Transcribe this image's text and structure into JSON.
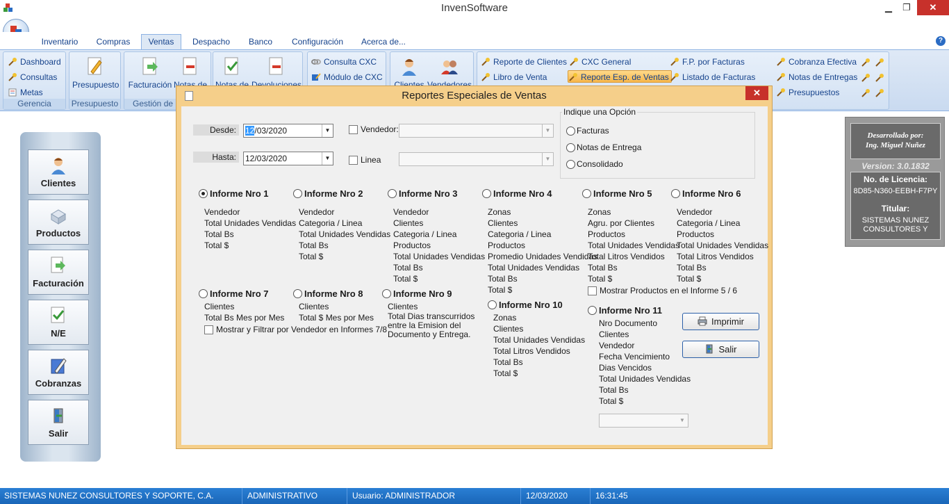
{
  "window": {
    "title": "InvenSoftware",
    "close": "✕",
    "min": "▁",
    "max": "❐"
  },
  "tabs": [
    "Inventario",
    "Compras",
    "Ventas",
    "Despacho",
    "Banco",
    "Configuración",
    "Acerca de..."
  ],
  "help": "?",
  "ribbon": {
    "gerencia": {
      "title": "Gerencia",
      "items": [
        "Dashboard",
        "Consultas",
        "Metas"
      ]
    },
    "presupuesto": {
      "title": "Presupuesto",
      "label": "Presupuesto"
    },
    "gestion": {
      "title": "Gestión de",
      "items": [
        "Facturación",
        "Notas de"
      ]
    },
    "notas": {
      "items": [
        "Notas de",
        "Devoluciones"
      ]
    },
    "cxc": {
      "items": [
        "Consulta CXC",
        "Módulo de CXC"
      ]
    },
    "clientes": {
      "items": [
        "Clientes",
        "Vendedores"
      ]
    },
    "reportes": {
      "col1": [
        "Reporte de Clientes",
        "Libro de Venta"
      ],
      "col2": [
        "CXC General",
        "Reporte Esp. de Ventas"
      ],
      "col3": [
        "F.P. por Facturas",
        "Listado de Facturas"
      ],
      "col4": [
        "Cobranza Efectiva",
        "Notas de Entregas",
        "Presupuestos"
      ]
    }
  },
  "leftnav": [
    "Clientes",
    "Productos",
    "Facturación",
    "N/E",
    "Cobranzas",
    "Salir"
  ],
  "info": {
    "dev_line1": "Desarrollado por:",
    "dev_line2": "Ing. Miguel Nuñez",
    "version": "Version: 3.0.1832",
    "license_label": "No. de Licencia:",
    "license_value": "8D85-N360-EEBH-F7PY",
    "holder_label": "Titular:",
    "holder_value": "SISTEMAS NUNEZ CONSULTORES Y SOPORTE, C.A."
  },
  "dialog": {
    "title": "Reportes Especiales de Ventas",
    "desde_label": "Desde:",
    "desde_sel": "12",
    "desde_rest": "/03/2020",
    "hasta_label": "Hasta:",
    "hasta_value": "12/03/2020",
    "vendedor_label": "Vendedor:",
    "linea_label": "Linea",
    "option_group": "Indique una Opción",
    "options": [
      "Facturas",
      "Notas de Entrega",
      "Consolidado"
    ],
    "reports": [
      {
        "title": "Informe Nro 1",
        "items": [
          "Vendedor",
          "Total Unidades Vendidas",
          "Total Bs",
          "Total $"
        ]
      },
      {
        "title": "Informe Nro 2",
        "items": [
          "Vendedor",
          "Categoria / Linea",
          "Total Unidades Vendidas",
          "Total Bs",
          "Total $"
        ]
      },
      {
        "title": "Informe Nro 3",
        "items": [
          "Vendedor",
          "Clientes",
          "Categoria / Linea",
          "Productos",
          "Total Unidades Vendidas",
          "Total Bs",
          "Total $"
        ]
      },
      {
        "title": "Informe Nro 4",
        "items": [
          "Zonas",
          "Clientes",
          "Categoria / Linea",
          "Productos",
          "Promedio Unidades Vendidas",
          "Total Unidades Vendidas",
          "Total Bs",
          "Total $"
        ]
      },
      {
        "title": "Informe Nro 5",
        "items": [
          "Zonas",
          "Agru. por Clientes",
          "Productos",
          "Total Unidades Vendidas",
          "Total Litros Vendidos",
          "Total Bs",
          "Total $"
        ]
      },
      {
        "title": "Informe Nro 6",
        "items": [
          "Vendedor",
          "Categoria / Linea",
          "Productos",
          "Total Unidades Vendidas",
          "Total Litros Vendidos",
          "Total Bs",
          "Total $"
        ]
      },
      {
        "title": "Informe Nro 7",
        "items": [
          "Clientes",
          "Total Bs Mes por Mes"
        ]
      },
      {
        "title": "Informe Nro 8",
        "items": [
          "Clientes",
          "Total $ Mes por Mes"
        ]
      },
      {
        "title": "Informe Nro 9",
        "items": [
          "Clientes",
          "Total Dias transcurridos",
          "entre la Emision del",
          "Documento y Entrega."
        ]
      },
      {
        "title": "Informe Nro 10",
        "items": [
          "Zonas",
          "Clientes",
          "Total Unidades Vendidas",
          "Total Litros Vendidos",
          "Total Bs",
          "Total $"
        ]
      },
      {
        "title": "Informe Nro 11",
        "items": [
          "Nro Documento",
          "Clientes",
          "Vendedor",
          "Fecha Vencimiento",
          "Dias Vencidos",
          "Total Unidades Vendidas",
          "Total Bs",
          "Total $"
        ]
      }
    ],
    "chk_mostrar_56": "Mostrar Productos en el Informe 5 / 6",
    "chk_filtrar_78": "Mostrar y Filtrar por Vendedor en Informes 7/8",
    "btn_imprimir": "Imprimir",
    "btn_salir": "Salir"
  },
  "status": [
    "SISTEMAS NUNEZ CONSULTORES Y SOPORTE, C.A.",
    "ADMINISTRATIVO",
    "Usuario: ADMINISTRADOR",
    "12/03/2020",
    "16:31:45"
  ]
}
